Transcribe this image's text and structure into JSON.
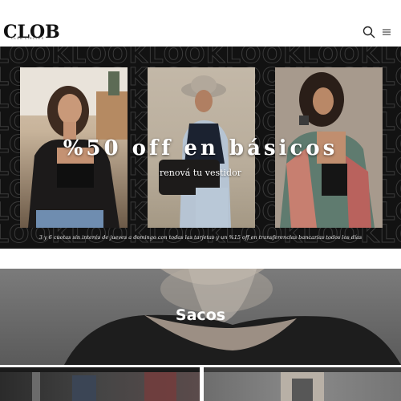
{
  "header": {
    "logo_text": "CLOB",
    "logo_tagline": "CLUB CIRCLES",
    "icons": [
      "search-icon",
      "menu-icon"
    ]
  },
  "hero": {
    "pattern_word": "LOOK",
    "title": "%50 off en básicos",
    "subtitle": "renová tu vestidor",
    "note": "3 y 6 cuotas sin interés de jueves a domingo con todas las tarjetas y un %15 off en transferencias bancarias todos los días"
  },
  "category": {
    "title": "Sacos"
  },
  "colors": {
    "hero_background": "#121212",
    "pattern_stroke": "#3a3a3a",
    "text_light": "#ffffff",
    "logo": "#111111"
  }
}
